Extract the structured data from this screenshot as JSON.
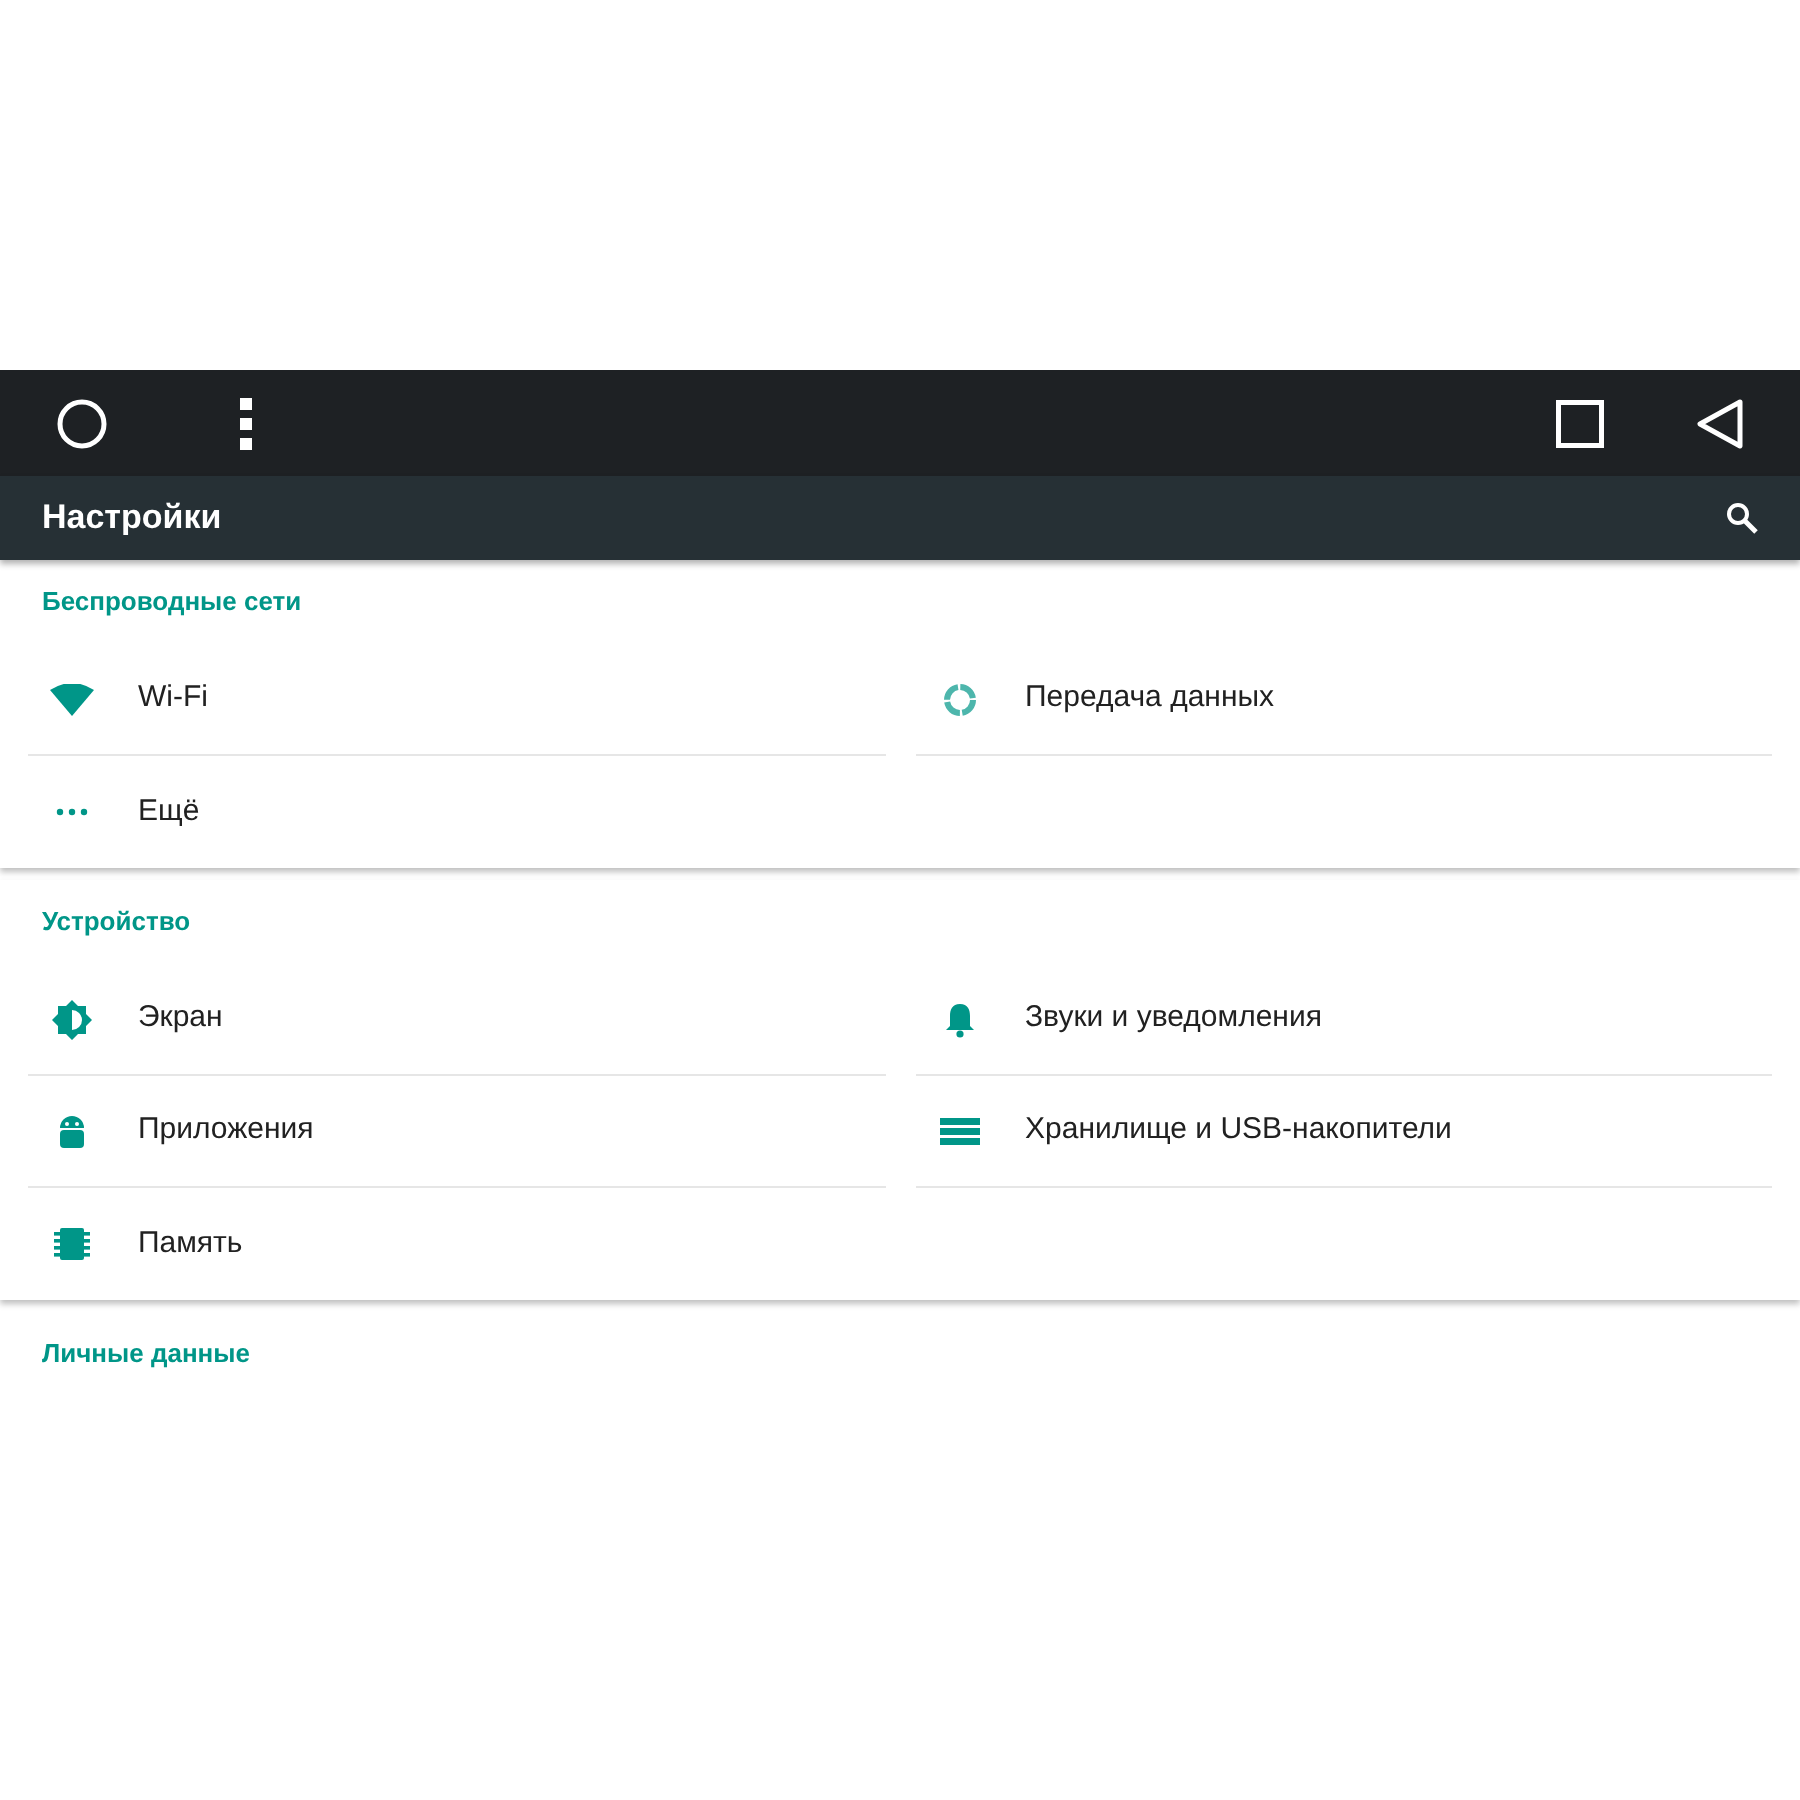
{
  "app_bar": {
    "title": "Настройки"
  },
  "sections": [
    {
      "title": "Беспроводные сети",
      "items": [
        {
          "kind": "wifi",
          "label": "Wi-Fi"
        },
        {
          "kind": "data",
          "label": "Передача данных"
        },
        {
          "kind": "more",
          "label": "Ещё"
        }
      ]
    },
    {
      "title": "Устройство",
      "items": [
        {
          "kind": "brightness",
          "label": "Экран"
        },
        {
          "kind": "sound",
          "label": "Звуки и уведомления"
        },
        {
          "kind": "apps",
          "label": "Приложения"
        },
        {
          "kind": "storage",
          "label": "Хранилище и USB-накопители"
        },
        {
          "kind": "memory",
          "label": "Память"
        }
      ]
    },
    {
      "title": "Личные данные"
    }
  ]
}
